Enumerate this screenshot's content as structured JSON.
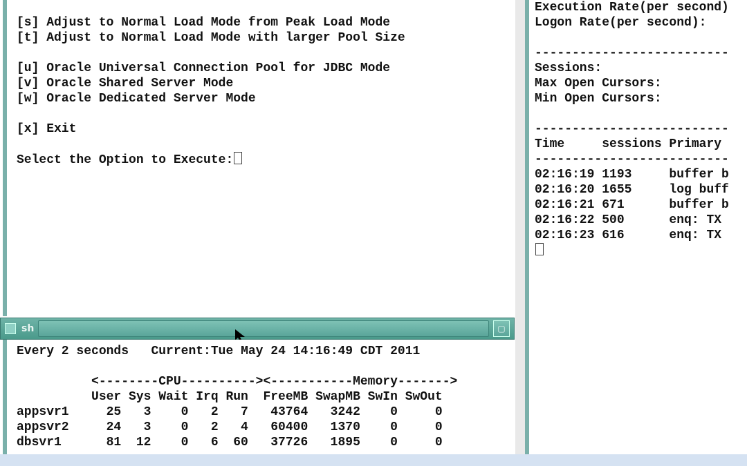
{
  "menu": {
    "s": "[s] Adjust to Normal Load Mode from Peak Load Mode",
    "t": "[t] Adjust to Normal Load Mode with larger Pool Size",
    "u": "[u] Oracle Universal Connection Pool for JDBC Mode",
    "v": "[v] Oracle Shared Server Mode",
    "w": "[w] Oracle Dedicated Server Mode",
    "x": "[x] Exit",
    "prompt": "Select the Option to Execute:"
  },
  "titlebar": {
    "label": "sh"
  },
  "stats": {
    "interval": "Every 2 seconds",
    "current_label": "Current:",
    "current_time": "Tue May 24 14:16:49 CDT 2011",
    "sections_line": "          <--------CPU----------><-----------Memory------->",
    "header_line": "          User Sys Wait Irq Run  FreeMB SwapMB SwIn SwOut",
    "rows": [
      {
        "host": "appsvr1",
        "user": 25,
        "sys": 3,
        "wait": 0,
        "irq": 2,
        "run": 7,
        "freemb": 43764,
        "swapmb": 3242,
        "swin": 0,
        "swout": 0
      },
      {
        "host": "appsvr2",
        "user": 24,
        "sys": 3,
        "wait": 0,
        "irq": 2,
        "run": 4,
        "freemb": 60400,
        "swapmb": 1370,
        "swin": 0,
        "swout": 0
      },
      {
        "host": "dbsvr1",
        "user": 81,
        "sys": 12,
        "wait": 0,
        "irq": 6,
        "run": 60,
        "freemb": 37726,
        "swapmb": 1895,
        "swin": 0,
        "swout": 0
      }
    ]
  },
  "right": {
    "exec_rate": "Execution Rate(per second)",
    "logon_rate": "Logon Rate(per second):",
    "dashes": "--------------------------",
    "sessions": "Sessions:",
    "max_cursors": "Max Open Cursors:",
    "min_cursors": "Min Open Cursors:",
    "table_header_time": "Time",
    "table_header_sessions": "sessions",
    "table_header_primary": "Primary",
    "rows": [
      {
        "time": "02:16:19",
        "sessions": "1193",
        "primary": "buffer b"
      },
      {
        "time": "02:16:20",
        "sessions": "1655",
        "primary": "log buff"
      },
      {
        "time": "02:16:21",
        "sessions": "671",
        "primary": "buffer b"
      },
      {
        "time": "02:16:22",
        "sessions": "500",
        "primary": "enq: TX"
      },
      {
        "time": "02:16:23",
        "sessions": "616",
        "primary": "enq: TX"
      }
    ]
  }
}
